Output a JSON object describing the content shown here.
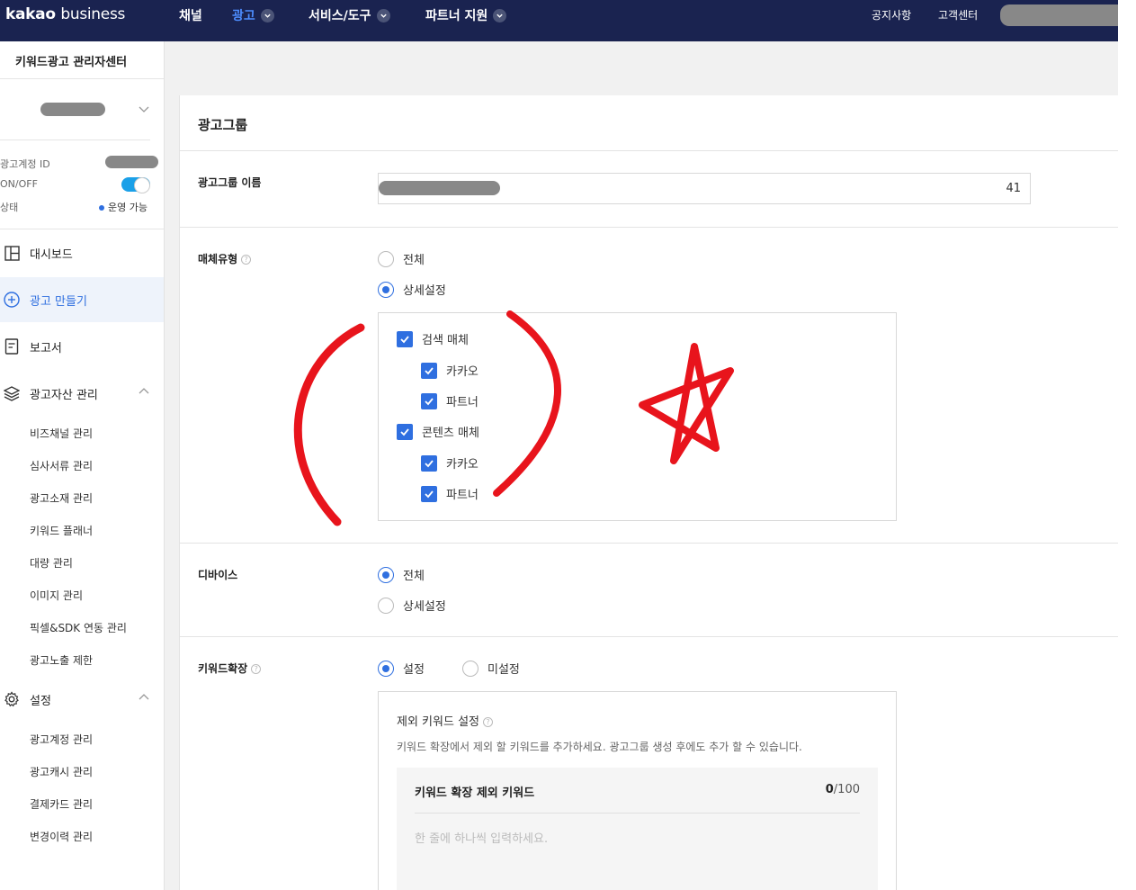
{
  "header": {
    "logo_brand": "kakao",
    "logo_sub": "business",
    "nav": [
      {
        "label": "채널"
      },
      {
        "label": "광고"
      },
      {
        "label": "서비스/도구"
      },
      {
        "label": "파트너 지원"
      }
    ],
    "links": {
      "notice": "공지사항",
      "support": "고객센터"
    }
  },
  "sidebar": {
    "title": "키워드광고 관리자센터",
    "account": {
      "id_label": "광고계정 ID",
      "onoff_label": "ON/OFF",
      "status_label": "상태",
      "status_value": "운영 가능"
    },
    "main_menu": [
      {
        "label": "대시보드",
        "icon": "dashboard-icon"
      },
      {
        "label": "광고 만들기",
        "icon": "plus-circle-icon"
      },
      {
        "label": "보고서",
        "icon": "report-icon"
      },
      {
        "label": "광고자산 관리",
        "icon": "layers-icon"
      },
      {
        "label": "설정",
        "icon": "gear-icon"
      }
    ],
    "asset_sub": [
      "비즈채널 관리",
      "심사서류 관리",
      "광고소재 관리",
      "키워드 플래너",
      "대량 관리",
      "이미지 관리",
      "픽셀&SDK 연동 관리",
      "광고노출 제한"
    ],
    "settings_sub": [
      "광고계정 관리",
      "광고캐시 관리",
      "결제카드 관리",
      "변경이력 관리"
    ]
  },
  "form": {
    "panel_title": "광고그룹",
    "name": {
      "label": "광고그룹 이름",
      "count": "41"
    },
    "media": {
      "label": "매체유형",
      "options": [
        "전체",
        "상세설정"
      ],
      "selected": "상세설정",
      "search_media": "검색 매체",
      "content_media": "콘텐츠 매체",
      "kakao": "카카오",
      "partner": "파트너"
    },
    "device": {
      "label": "디바이스",
      "options": [
        "전체",
        "상세설정"
      ],
      "selected": "전체"
    },
    "keyword_ext": {
      "label": "키워드확장",
      "options": [
        "설정",
        "미설정"
      ],
      "selected": "설정",
      "exclude_title": "제외 키워드 설정",
      "exclude_desc": "키워드 확장에서 제외 할 키워드를 추가하세요. 광고그룹 생성 후에도 추가 할 수 있습니다.",
      "exclude_box_title": "키워드 확장 제외 키워드",
      "exclude_count": "0",
      "exclude_max": "/100",
      "exclude_placeholder": "한 줄에 하나씩 입력하세요."
    }
  },
  "colors": {
    "nav_bg": "#1a2350",
    "accent": "#2f6fe0",
    "annotation": "#e8141c"
  }
}
